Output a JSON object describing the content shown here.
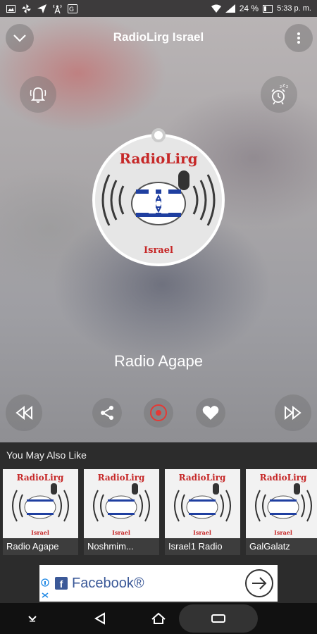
{
  "status_bar": {
    "battery": "24 %",
    "time": "5:33 p. m."
  },
  "header": {
    "title": "RadioLirg Israel"
  },
  "player": {
    "station": "Radio Agape",
    "logo_text": "RadioLirg",
    "logo_subtext": "Israel"
  },
  "suggestions": {
    "title": "You May Also Like",
    "items": [
      {
        "label": "Radio Agape"
      },
      {
        "label": "Noshmim..."
      },
      {
        "label": "Israel1 Radio"
      },
      {
        "label": "GalGalatz"
      }
    ]
  },
  "ad": {
    "text": "Facebook®"
  },
  "colors": {
    "record_red": "#e53935",
    "brand_red": "#c62828",
    "facebook_blue": "#3b5998"
  }
}
